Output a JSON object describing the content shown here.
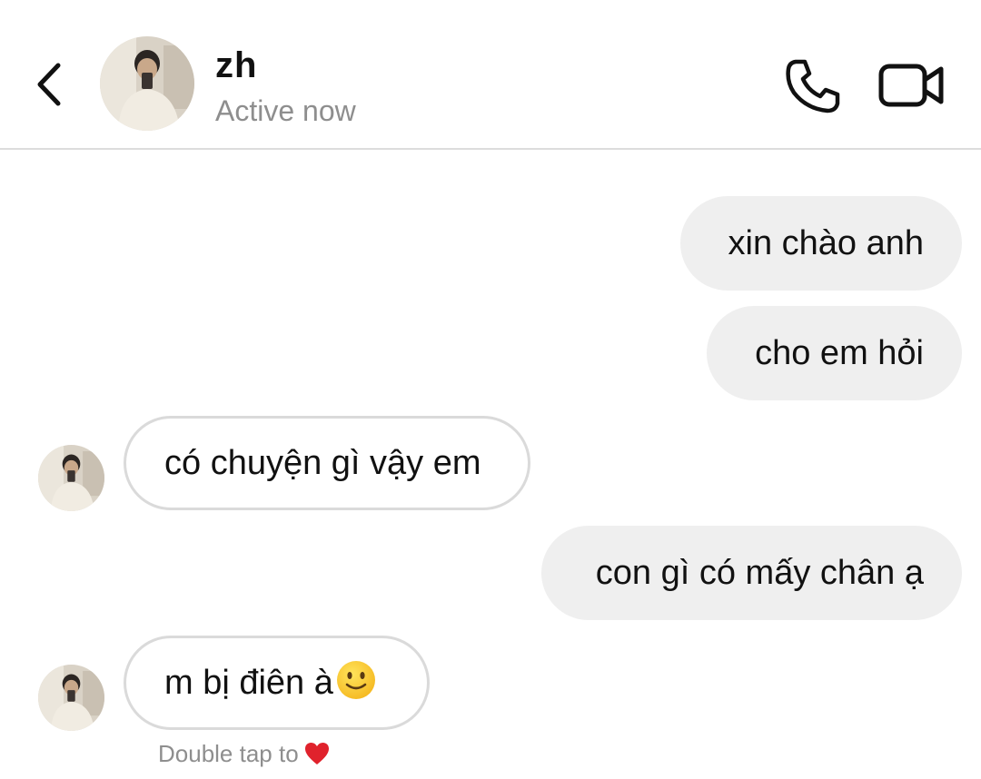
{
  "header": {
    "contact_name": "zh",
    "status": "Active now",
    "icons": {
      "back": "chevron-left-icon",
      "call": "phone-icon",
      "video": "video-camera-icon"
    }
  },
  "messages": [
    {
      "direction": "outgoing",
      "text": "xin chào anh"
    },
    {
      "direction": "outgoing",
      "text": "cho em hỏi"
    },
    {
      "direction": "incoming",
      "text": "có chuyện gì vậy em"
    },
    {
      "direction": "outgoing",
      "text": "con gì có mấy chân ạ"
    },
    {
      "direction": "incoming",
      "text": "m bị điên à",
      "emoji": "slightly-smiling-face"
    }
  ],
  "reaction_hint": {
    "text": "Double tap to",
    "icon": "heart-icon"
  },
  "colors": {
    "outgoing_bubble": "#efefef",
    "incoming_border": "#dadada",
    "secondary_text": "#8e8e8e",
    "heart": "#e0222c"
  }
}
